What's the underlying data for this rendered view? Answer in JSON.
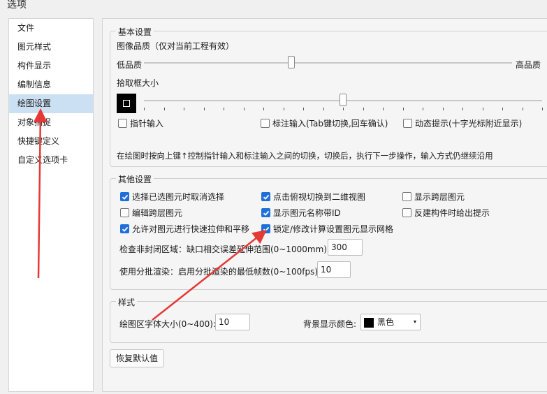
{
  "window": {
    "title": "选项"
  },
  "sidebar": {
    "items": [
      {
        "label": "文件"
      },
      {
        "label": "图元样式"
      },
      {
        "label": "构件显示"
      },
      {
        "label": "编制信息"
      },
      {
        "label": "绘图设置"
      },
      {
        "label": "对象捕捉"
      },
      {
        "label": "快捷键定义"
      },
      {
        "label": "自定义选项卡"
      }
    ],
    "selected": "绘图设置"
  },
  "basic": {
    "legend": "基本设置",
    "quality_label": "图像品质（仅对当前工程有效）",
    "quality_low": "低品质",
    "quality_high": "高品质",
    "quality_level": 0.4,
    "pick_label": "拾取框大小",
    "pick_level": 0.5,
    "options": [
      {
        "label": "指针输入",
        "checked": false
      },
      {
        "label": "标注输入(Tab键切换,回车确认)",
        "checked": false
      },
      {
        "label": "动态提示(十字光标附近显示)",
        "checked": false
      }
    ],
    "hint": "在绘图时按向上键↑控制指针输入和标注输入之间的切换，切换后，执行下一步操作，输入方式仍继续沿用"
  },
  "other": {
    "legend": "其他设置",
    "options": [
      {
        "label": "选择已选图元时取消选择",
        "checked": true
      },
      {
        "label": "点击俯视切换到二维视图",
        "checked": true
      },
      {
        "label": "显示跨层图元",
        "checked": false
      },
      {
        "label": "编辑跨层图元",
        "checked": false
      },
      {
        "label": "显示图元名称带ID",
        "checked": true
      },
      {
        "label": "反建构件时给出提示",
        "checked": false
      },
      {
        "label": "允许对图元进行快速拉伸和平移",
        "checked": true
      },
      {
        "label": "锁定/修改计算设置图元显示网格",
        "checked": true
      }
    ],
    "check_label": "检查非封闭区域：缺口相交误差延伸范围(0~1000mm):",
    "check_value": "300",
    "batch_label": "使用分批渲染：启用分批渲染的最低帧数(0~100fps):",
    "batch_value": "10"
  },
  "style": {
    "legend": "样式",
    "font_label": "绘图区字体大小(0~400):",
    "font_value": "10",
    "bg_label": "背景显示颜色:",
    "bg_value": "黑色",
    "bg_color": "#000000"
  },
  "restore_button": "恢复默认值",
  "accent": "#1e6fd9",
  "annotation_color": "#e53935"
}
